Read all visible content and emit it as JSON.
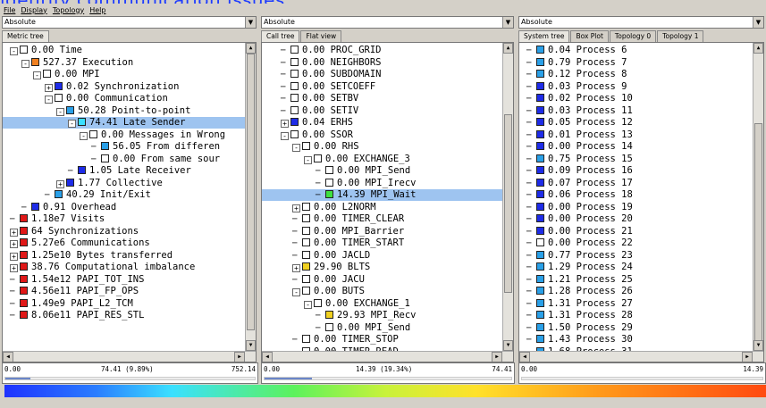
{
  "banner_title": "identify communication issues",
  "menu": [
    "File",
    "Display",
    "Topology",
    "Help"
  ],
  "colors": {
    "accent": "#1e3cff",
    "selection": "#9ec4f0"
  },
  "panes": [
    {
      "combo": "Absolute",
      "tabs": [
        "Metric tree"
      ],
      "rows": [
        {
          "level": 0,
          "exp": "-",
          "color": "#ffffff",
          "label": "0.00 Time"
        },
        {
          "level": 1,
          "exp": "-",
          "color": "#f08020",
          "label": "527.37 Execution"
        },
        {
          "level": 2,
          "exp": "-",
          "color": "#ffffff",
          "label": "0.00 MPI"
        },
        {
          "level": 3,
          "exp": "+",
          "color": "#1e2ce8",
          "label": "0.02 Synchronization"
        },
        {
          "level": 3,
          "exp": "-",
          "color": "#ffffff",
          "label": "0.00 Communication"
        },
        {
          "level": 4,
          "exp": "-",
          "color": "#2aa0e8",
          "label": "50.28 Point-to-point"
        },
        {
          "level": 5,
          "exp": "-",
          "color": "#3ae0ff",
          "label": "74.41 Late Sender",
          "selected": true
        },
        {
          "level": 6,
          "exp": "-",
          "color": "#ffffff",
          "label": "0.00 Messages in Wrong"
        },
        {
          "level": 7,
          "exp": "",
          "color": "#2aa0e8",
          "label": "56.05 From differen"
        },
        {
          "level": 7,
          "exp": "",
          "color": "#ffffff",
          "label": "0.00 From same sour"
        },
        {
          "level": 5,
          "exp": "",
          "color": "#1e2ce8",
          "label": "1.05 Late Receiver"
        },
        {
          "level": 4,
          "exp": "+",
          "color": "#1e2ce8",
          "label": "1.77 Collective"
        },
        {
          "level": 3,
          "exp": "",
          "color": "#2aa0e8",
          "label": "40.29 Init/Exit"
        },
        {
          "level": 1,
          "exp": "",
          "color": "#1e2ce8",
          "label": "0.91 Overhead"
        },
        {
          "level": 0,
          "exp": "",
          "color": "#e01818",
          "label": "1.18e7 Visits"
        },
        {
          "level": 0,
          "exp": "+",
          "color": "#e01818",
          "label": "64 Synchronizations"
        },
        {
          "level": 0,
          "exp": "+",
          "color": "#e01818",
          "label": "5.27e6 Communications"
        },
        {
          "level": 0,
          "exp": "+",
          "color": "#e01818",
          "label": "1.25e10 Bytes transferred"
        },
        {
          "level": 0,
          "exp": "+",
          "color": "#e01818",
          "label": "38.76 Computational imbalance"
        },
        {
          "level": 0,
          "exp": "",
          "color": "#e01818",
          "label": "1.54e12 PAPI_TOT_INS"
        },
        {
          "level": 0,
          "exp": "",
          "color": "#e01818",
          "label": "4.56e11 PAPI_FP_OPS"
        },
        {
          "level": 0,
          "exp": "",
          "color": "#e01818",
          "label": "1.49e9 PAPI_L2_TCM"
        },
        {
          "level": 0,
          "exp": "",
          "color": "#e01818",
          "label": "8.06e11 PAPI_RES_STL"
        }
      ],
      "status": {
        "min": "0.00",
        "mid": "74.41 (9.89%)",
        "max": "752.14",
        "fill": 0.099
      }
    },
    {
      "combo": "Absolute",
      "tabs": [
        "Call tree",
        "Flat view"
      ],
      "rows": [
        {
          "level": 1,
          "exp": "",
          "color": "#ffffff",
          "label": "0.00 PROC_GRID"
        },
        {
          "level": 1,
          "exp": "",
          "color": "#ffffff",
          "label": "0.00 NEIGHBORS"
        },
        {
          "level": 1,
          "exp": "",
          "color": "#ffffff",
          "label": "0.00 SUBDOMAIN"
        },
        {
          "level": 1,
          "exp": "",
          "color": "#ffffff",
          "label": "0.00 SETCOEFF"
        },
        {
          "level": 1,
          "exp": "",
          "color": "#ffffff",
          "label": "0.00 SETBV"
        },
        {
          "level": 1,
          "exp": "",
          "color": "#ffffff",
          "label": "0.00 SETIV"
        },
        {
          "level": 1,
          "exp": "+",
          "color": "#1e2ce8",
          "label": "0.04 ERHS"
        },
        {
          "level": 1,
          "exp": "-",
          "color": "#ffffff",
          "label": "0.00 SSOR"
        },
        {
          "level": 2,
          "exp": "-",
          "color": "#ffffff",
          "label": "0.00 RHS"
        },
        {
          "level": 3,
          "exp": "-",
          "color": "#ffffff",
          "label": "0.00 EXCHANGE_3"
        },
        {
          "level": 4,
          "exp": "",
          "color": "#ffffff",
          "label": "0.00 MPI_Send"
        },
        {
          "level": 4,
          "exp": "",
          "color": "#ffffff",
          "label": "0.00 MPI_Irecv"
        },
        {
          "level": 4,
          "exp": "",
          "color": "#3ee040",
          "label": "14.39 MPI_Wait",
          "selected": true
        },
        {
          "level": 2,
          "exp": "+",
          "color": "#ffffff",
          "label": "0.00 L2NORM"
        },
        {
          "level": 2,
          "exp": "",
          "color": "#ffffff",
          "label": "0.00 TIMER_CLEAR"
        },
        {
          "level": 2,
          "exp": "",
          "color": "#ffffff",
          "label": "0.00 MPI_Barrier"
        },
        {
          "level": 2,
          "exp": "",
          "color": "#ffffff",
          "label": "0.00 TIMER_START"
        },
        {
          "level": 2,
          "exp": "",
          "color": "#ffffff",
          "label": "0.00 JACLD"
        },
        {
          "level": 2,
          "exp": "+",
          "color": "#f0d020",
          "label": "29.90 BLTS"
        },
        {
          "level": 2,
          "exp": "",
          "color": "#ffffff",
          "label": "0.00 JACU"
        },
        {
          "level": 2,
          "exp": "-",
          "color": "#ffffff",
          "label": "0.00 BUTS"
        },
        {
          "level": 3,
          "exp": "-",
          "color": "#ffffff",
          "label": "0.00 EXCHANGE_1"
        },
        {
          "level": 4,
          "exp": "",
          "color": "#f0d020",
          "label": "29.93 MPI_Recv"
        },
        {
          "level": 4,
          "exp": "",
          "color": "#ffffff",
          "label": "0.00 MPI_Send"
        },
        {
          "level": 2,
          "exp": "",
          "color": "#ffffff",
          "label": "0.00 TIMER_STOP"
        },
        {
          "level": 2,
          "exp": "",
          "color": "#ffffff",
          "label": "0.00 TIMER_READ"
        }
      ],
      "status": {
        "min": "0.00",
        "mid": "14.39 (19.34%)",
        "max": "74.41",
        "fill": 0.193
      }
    },
    {
      "combo": "Absolute",
      "tabs": [
        "System tree",
        "Box Plot",
        "Topology 0",
        "Topology 1"
      ],
      "rows": [
        {
          "level": 0,
          "exp": "",
          "color": "#2aa0e8",
          "label": "0.04 Process 6"
        },
        {
          "level": 0,
          "exp": "",
          "color": "#2aa0e8",
          "label": "0.79 Process 7"
        },
        {
          "level": 0,
          "exp": "",
          "color": "#2aa0e8",
          "label": "0.12 Process 8"
        },
        {
          "level": 0,
          "exp": "",
          "color": "#1e2ce8",
          "label": "0.03 Process 9"
        },
        {
          "level": 0,
          "exp": "",
          "color": "#1e2ce8",
          "label": "0.02 Process 10"
        },
        {
          "level": 0,
          "exp": "",
          "color": "#1e2ce8",
          "label": "0.03 Process 11"
        },
        {
          "level": 0,
          "exp": "",
          "color": "#1e2ce8",
          "label": "0.05 Process 12"
        },
        {
          "level": 0,
          "exp": "",
          "color": "#1e2ce8",
          "label": "0.01 Process 13"
        },
        {
          "level": 0,
          "exp": "",
          "color": "#1e2ce8",
          "label": "0.00 Process 14"
        },
        {
          "level": 0,
          "exp": "",
          "color": "#2aa0e8",
          "label": "0.75 Process 15"
        },
        {
          "level": 0,
          "exp": "",
          "color": "#1e2ce8",
          "label": "0.09 Process 16"
        },
        {
          "level": 0,
          "exp": "",
          "color": "#1e2ce8",
          "label": "0.07 Process 17"
        },
        {
          "level": 0,
          "exp": "",
          "color": "#1e2ce8",
          "label": "0.06 Process 18"
        },
        {
          "level": 0,
          "exp": "",
          "color": "#1e2ce8",
          "label": "0.00 Process 19"
        },
        {
          "level": 0,
          "exp": "",
          "color": "#1e2ce8",
          "label": "0.00 Process 20"
        },
        {
          "level": 0,
          "exp": "",
          "color": "#1e2ce8",
          "label": "0.00 Process 21"
        },
        {
          "level": 0,
          "exp": "",
          "color": "#ffffff",
          "label": "0.00 Process 22"
        },
        {
          "level": 0,
          "exp": "",
          "color": "#2aa0e8",
          "label": "0.77 Process 23"
        },
        {
          "level": 0,
          "exp": "",
          "color": "#2aa0e8",
          "label": "1.29 Process 24"
        },
        {
          "level": 0,
          "exp": "",
          "color": "#2aa0e8",
          "label": "1.21 Process 25"
        },
        {
          "level": 0,
          "exp": "",
          "color": "#2aa0e8",
          "label": "1.28 Process 26"
        },
        {
          "level": 0,
          "exp": "",
          "color": "#2aa0e8",
          "label": "1.31 Process 27"
        },
        {
          "level": 0,
          "exp": "",
          "color": "#2aa0e8",
          "label": "1.31 Process 28"
        },
        {
          "level": 0,
          "exp": "",
          "color": "#2aa0e8",
          "label": "1.50 Process 29"
        },
        {
          "level": 0,
          "exp": "",
          "color": "#2aa0e8",
          "label": "1.43 Process 30"
        },
        {
          "level": 0,
          "exp": "",
          "color": "#2aa0e8",
          "label": "1.68 Process 31"
        }
      ],
      "status": {
        "min": "0.00",
        "mid": "",
        "max": "14.39",
        "fill": 0.0
      }
    }
  ]
}
